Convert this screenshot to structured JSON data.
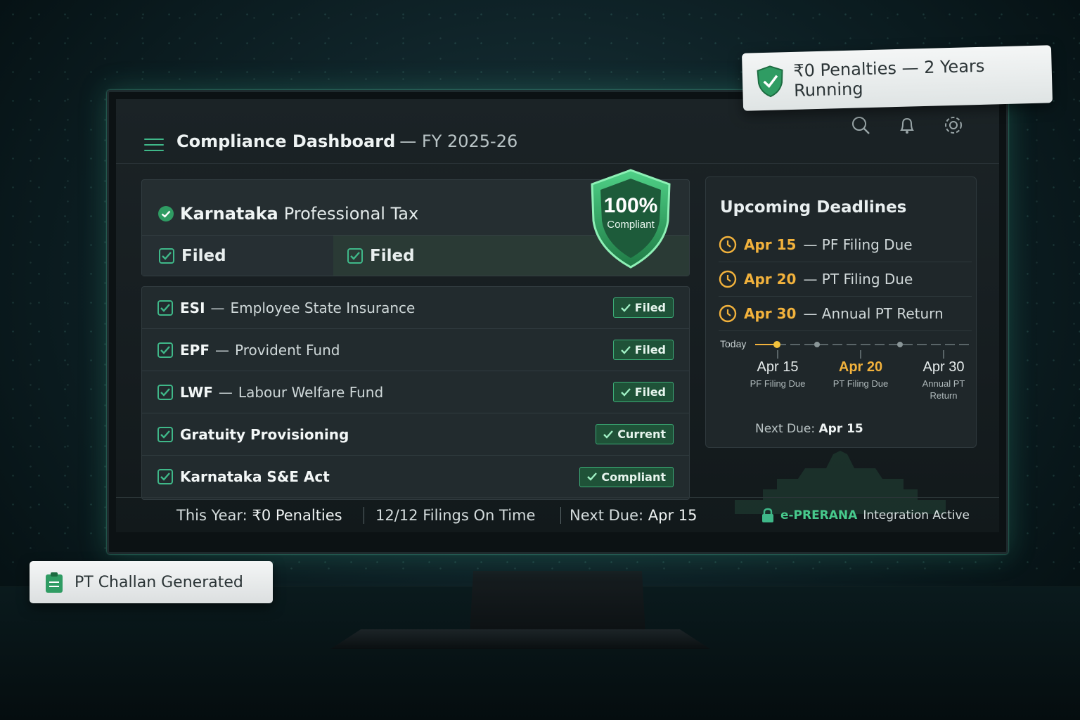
{
  "header": {
    "title": "Compliance Dashboard",
    "fy": "— FY 2025-26"
  },
  "professional_tax": {
    "brand": "Karnataka",
    "name": "Professional Tax",
    "status_1": "Filed",
    "status_2": "Filed",
    "shield_percent": "100%",
    "shield_label": "Compliant"
  },
  "filings": [
    {
      "code": "ESI",
      "sep": "—",
      "desc": "Employee State Insurance",
      "status": "Filed"
    },
    {
      "code": "EPF",
      "sep": "—",
      "desc": "Provident Fund",
      "status": "Filed"
    },
    {
      "code": "LWF",
      "sep": "—",
      "desc": "Labour Welfare Fund",
      "status": "Filed"
    },
    {
      "code": "Gratuity Provisioning",
      "sep": "",
      "desc": "",
      "status": "Current"
    },
    {
      "code": "Karnataka S&E Act",
      "sep": "",
      "desc": "",
      "status": "Compliant"
    }
  ],
  "deadlines": {
    "title": "Upcoming Deadlines",
    "items": [
      {
        "date": "Apr 15",
        "text": "— PF Filing Due"
      },
      {
        "date": "Apr 20",
        "text": "— PT Filing Due"
      },
      {
        "date": "Apr 30",
        "text": "— Annual PT Return"
      }
    ],
    "timeline": {
      "today_label": "Today",
      "points": [
        {
          "date": "Apr 15",
          "label": "PF Filing Due",
          "highlight": false
        },
        {
          "date": "Apr 20",
          "label": "PT Filing Due",
          "highlight": true
        },
        {
          "date": "Apr 30",
          "label": "Annual PT Return",
          "highlight": false
        }
      ]
    },
    "next_due_label": "Next Due:",
    "next_due_value": "Apr 15"
  },
  "footer": {
    "year_label": "This Year:",
    "year_value": "₹0 Penalties",
    "filings_on_time": "12/12 Filings On Time",
    "next_due_label": "Next Due:",
    "next_due_value": "Apr 15",
    "integration_brand": "e-PRERANA",
    "integration_status": "Integration Active"
  },
  "float_top": {
    "text": "₹0 Penalties — 2 Years Running"
  },
  "float_bottom": {
    "text": "PT Challan Generated"
  },
  "colors": {
    "accent": "#3fb889",
    "deadline": "#f2b23c",
    "badge_bg": "#1f5238"
  }
}
